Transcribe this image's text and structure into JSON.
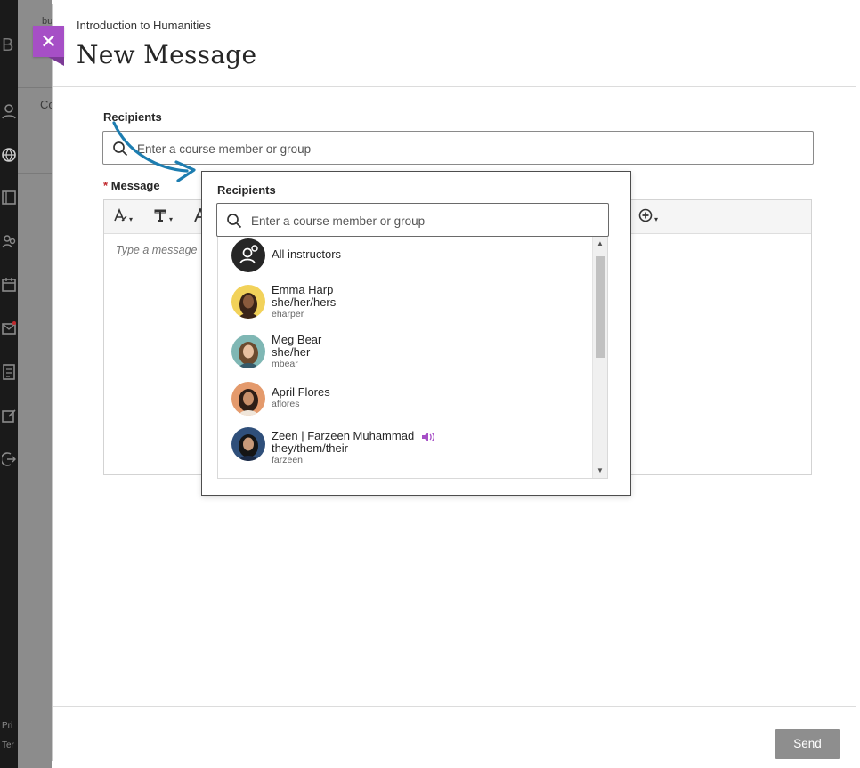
{
  "background": {
    "peek_letters": [
      "B",
      "bu",
      "Co"
    ],
    "footer_lines": [
      "Pri",
      "Ter"
    ]
  },
  "header": {
    "breadcrumb": "Introduction to Humanities",
    "title": "New Message",
    "close_symbol": "✕"
  },
  "recipients": {
    "label": "Recipients",
    "placeholder": "Enter a course member or group"
  },
  "message": {
    "required_mark": "*",
    "label": "Message",
    "placeholder": "Type a message"
  },
  "dropdown": {
    "label": "Recipients",
    "placeholder": "Enter a course member or group",
    "items": [
      {
        "name": "All instructors",
        "pronouns": "",
        "username": ""
      },
      {
        "name": "Emma Harp",
        "pronouns": "she/her/hers",
        "username": "eharper"
      },
      {
        "name": "Meg Bear",
        "pronouns": "she/her",
        "username": "mbear"
      },
      {
        "name": "April Flores",
        "pronouns": "",
        "username": "aflores"
      },
      {
        "name": "Zeen | Farzeen Muhammad",
        "pronouns": "they/them/their",
        "username": "farzeen"
      }
    ]
  },
  "footer": {
    "send_label": "Send"
  },
  "colors": {
    "close_button": "#a64fc6",
    "arrow": "#1d7db0",
    "audio_icon": "#a64fc6",
    "send_button": "#8e8e8e"
  }
}
